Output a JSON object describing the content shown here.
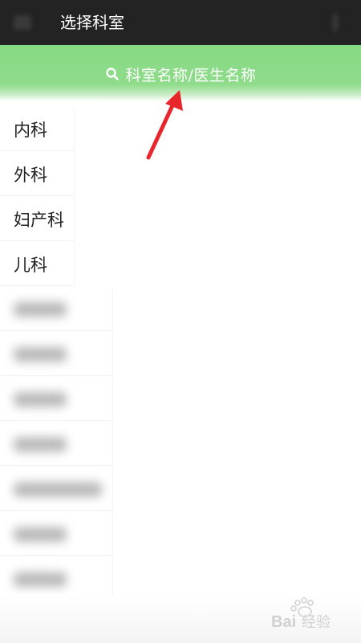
{
  "header": {
    "title": "选择科室",
    "back_icon": "back-arrow-icon",
    "menu_icon": "more-vert-icon"
  },
  "search": {
    "placeholder": "科室名称/医生名称",
    "icon": "search-icon"
  },
  "departments": [
    {
      "label": "内科"
    },
    {
      "label": "外科"
    },
    {
      "label": "妇产科"
    },
    {
      "label": "儿科"
    }
  ],
  "colors": {
    "app_bar": "#232323",
    "search_bar": "#8cdb88",
    "annotation_arrow": "#e8252b"
  },
  "watermark": {
    "text": "Bai 经验"
  }
}
